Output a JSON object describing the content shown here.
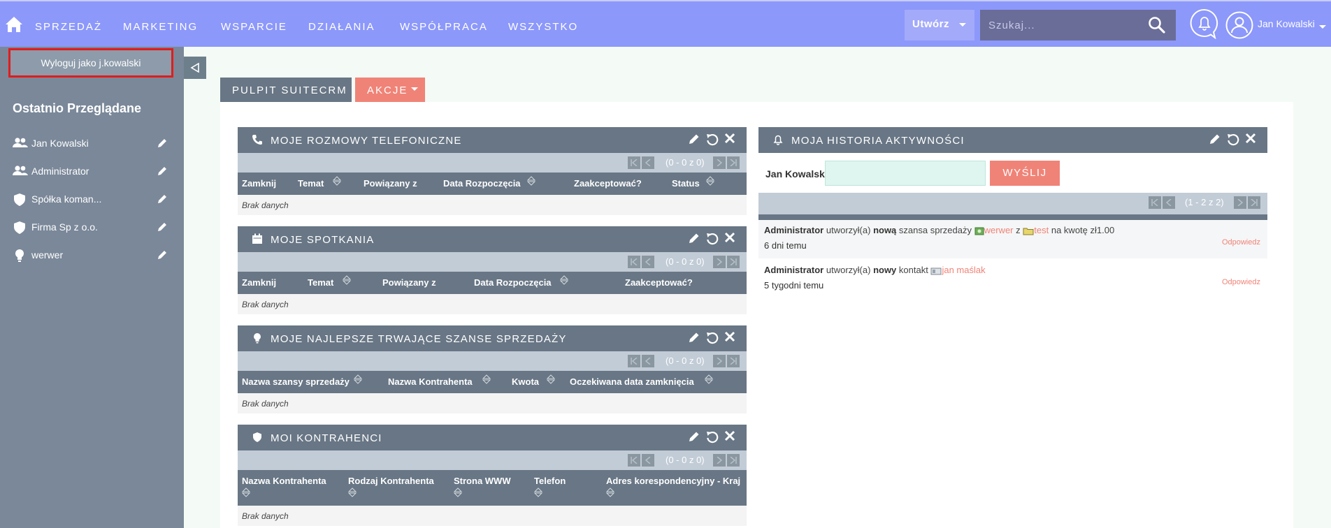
{
  "topnav": {
    "items": [
      "SPRZEDAŻ",
      "MARKETING",
      "WSPARCIE",
      "DZIAŁANIA",
      "WSPÓŁPRACA",
      "WSZYSTKO"
    ],
    "create_label": "Utwórz",
    "search_placeholder": "Szukaj...",
    "user_name": "Jan Kowalski"
  },
  "sidebar": {
    "logout_as_label": "Wyloguj jako j.kowalski",
    "recent_title": "Ostatnio Przeglądane",
    "recent_items": [
      {
        "label": "Jan Kowalski",
        "icon": "contacts-icon"
      },
      {
        "label": "Administrator",
        "icon": "contacts-icon"
      },
      {
        "label": "Spółka koman...",
        "icon": "shield-icon"
      },
      {
        "label": "Firma Sp z o.o.",
        "icon": "shield-icon"
      },
      {
        "label": "werwer",
        "icon": "lightbulb-icon"
      }
    ]
  },
  "page_tabs": {
    "dashboard": "PULPIT SUITECRM",
    "actions": "AKCJE"
  },
  "dashlets": {
    "calls": {
      "title": "MOJE ROZMOWY TELEFONICZNE",
      "pager": "(0 - 0 z 0)",
      "columns": [
        "Zamknij",
        "Temat",
        "Powiązany z",
        "Data Rozpoczęcia",
        "Zaakceptować?",
        "Status"
      ],
      "empty": "Brak danych"
    },
    "meetings": {
      "title": "MOJE SPOTKANIA",
      "pager": "(0 - 0 z 0)",
      "columns": [
        "Zamknij",
        "Temat",
        "Powiązany z",
        "Data Rozpoczęcia",
        "Zaakceptować?"
      ],
      "empty": "Brak danych"
    },
    "opportunities": {
      "title": "MOJE NAJLEPSZE TRWAJĄCE SZANSE SPRZEDAŻY",
      "pager": "(0 - 0 z 0)",
      "columns": [
        "Nazwa szansy sprzedaży",
        "Nazwa Kontrahenta",
        "Kwota",
        "Oczekiwana data zamknięcia"
      ],
      "empty": "Brak danych"
    },
    "accounts": {
      "title": "MOI KONTRAHENCI",
      "pager": "(0 - 0 z 0)",
      "columns": [
        "Nazwa Kontrahenta",
        "Rodzaj Kontrahenta",
        "Strona WWW",
        "Telefon",
        "Adres korespondencyjny - Kraj"
      ],
      "empty": "Brak danych"
    },
    "history": {
      "title": "MOJA HISTORIA AKTYWNOŚCI",
      "user": "Jan Kowalski",
      "send_label": "WYŚLIJ",
      "pager": "(1 - 2 z 2)",
      "reply_label": "Odpowiedz",
      "entries": [
        {
          "actor": "Administrator",
          "verb": "utworzył(a)",
          "adj": "nową",
          "noun": "szansa sprzedaży",
          "link1": "werwer",
          "mid": "z",
          "link2": "test",
          "tail": "na kwotę zł1.00",
          "time": "6 dni temu"
        },
        {
          "actor": "Administrator",
          "verb": "utworzył(a)",
          "adj": "nowy",
          "noun": "kontakt",
          "link1": "jan maślak",
          "time": "5 tygodni temu"
        }
      ]
    }
  },
  "colors": {
    "topbar": "#8c98fa",
    "sidebar": "#7a8899",
    "dashlet_header": "#687685",
    "accent": "#f08377"
  }
}
